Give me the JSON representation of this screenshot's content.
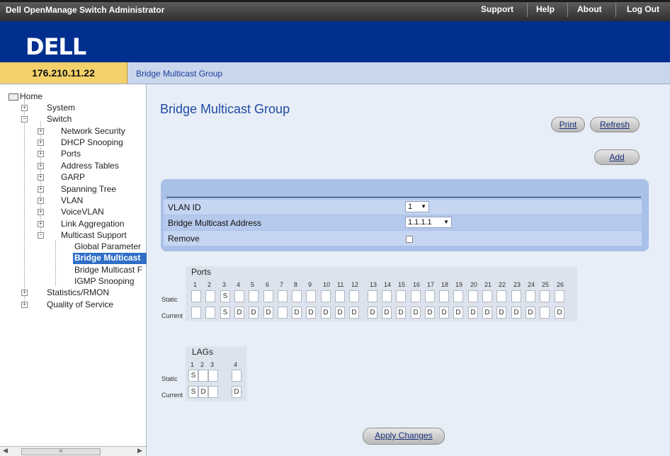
{
  "header": {
    "app_title": "Dell OpenManage Switch Administrator",
    "links": [
      "Support",
      "Help",
      "About",
      "Log Out"
    ],
    "logo": "DELL",
    "ip": "176.210.11.22",
    "breadcrumb": "Bridge Multicast Group"
  },
  "nav": {
    "home": "Home",
    "system": "System",
    "switch": "Switch",
    "switch_children": [
      "Network Security",
      "DHCP Snooping",
      "Ports",
      "Address Tables",
      "GARP",
      "Spanning Tree",
      "VLAN",
      "VoiceVLAN",
      "Link Aggregation",
      "Multicast Support"
    ],
    "multicast_children": [
      "Global Parameter",
      "Bridge Multicast",
      "Bridge Multicast F",
      "IGMP Snooping"
    ],
    "bottom": [
      "Statistics/RMON",
      "Quality of Service"
    ],
    "scroll_thumb": "III"
  },
  "page": {
    "title": "Bridge Multicast Group",
    "print_label": "Print",
    "refresh_label": "Refresh",
    "add_label": "Add",
    "apply_label": "Apply Changes"
  },
  "form": {
    "vlan_label": "VLAN ID",
    "vlan_value": "1",
    "address_label": "Bridge Multicast Address",
    "address_value": "1.1.1.1",
    "remove_label": "Remove"
  },
  "ports": {
    "title": "Ports",
    "static_label": "Static",
    "current_label": "Current",
    "numbers": [
      "1",
      "2",
      "3",
      "4",
      "5",
      "6",
      "7",
      "8",
      "9",
      "10",
      "11",
      "12",
      "13",
      "14",
      "15",
      "16",
      "17",
      "18",
      "19",
      "20",
      "21",
      "22",
      "23",
      "24",
      "25",
      "26"
    ],
    "static": [
      "",
      "",
      "S",
      "",
      "",
      "",
      "",
      "",
      "",
      "",
      "",
      "",
      "",
      "",
      "",
      "",
      "",
      "",
      "",
      "",
      "",
      "",
      "",
      "",
      "",
      ""
    ],
    "current": [
      "",
      "",
      "S",
      "D",
      "D",
      "D",
      "",
      "D",
      "D",
      "D",
      "D",
      "D",
      "D",
      "D",
      "D",
      "D",
      "D",
      "D",
      "D",
      "D",
      "D",
      "D",
      "D",
      "D",
      "",
      "D"
    ]
  },
  "lags": {
    "title": "LAGs",
    "static_label": "Static",
    "current_label": "Current",
    "numbers": [
      "1",
      "2",
      "3",
      "4"
    ],
    "static": [
      "S",
      "",
      "",
      ""
    ],
    "current": [
      "S",
      "D",
      "",
      "D"
    ]
  }
}
